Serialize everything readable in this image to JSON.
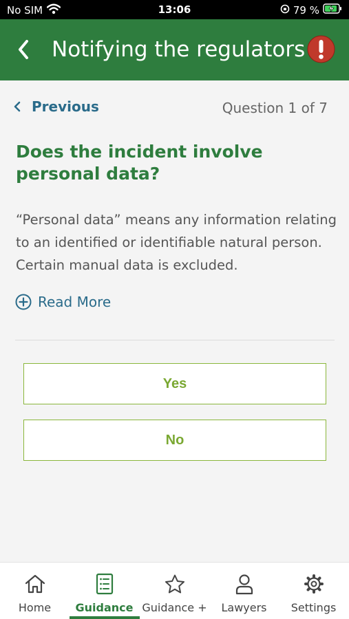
{
  "status_bar": {
    "carrier": "No SIM",
    "time": "13:06",
    "battery": "79 %"
  },
  "header": {
    "title": "Notifying the regulators"
  },
  "nav": {
    "previous_label": "Previous",
    "question_counter": "Question 1 of 7"
  },
  "question": {
    "title": "Does the incident involve personal data?",
    "description": "“Personal data” means any information relating to an identified or identifiable natural person. Certain manual data is excluded.",
    "read_more_label": "Read More"
  },
  "answers": {
    "yes_label": "Yes",
    "no_label": "No"
  },
  "tabs": {
    "home": "Home",
    "guidance": "Guidance",
    "guidance_plus": "Guidance +",
    "lawyers": "Lawyers",
    "settings": "Settings",
    "active": "guidance"
  },
  "colors": {
    "header_green": "#2e7d3e",
    "link_blue": "#2a6b8a",
    "answer_green": "#7aa832",
    "alert_red": "#c0392b"
  }
}
